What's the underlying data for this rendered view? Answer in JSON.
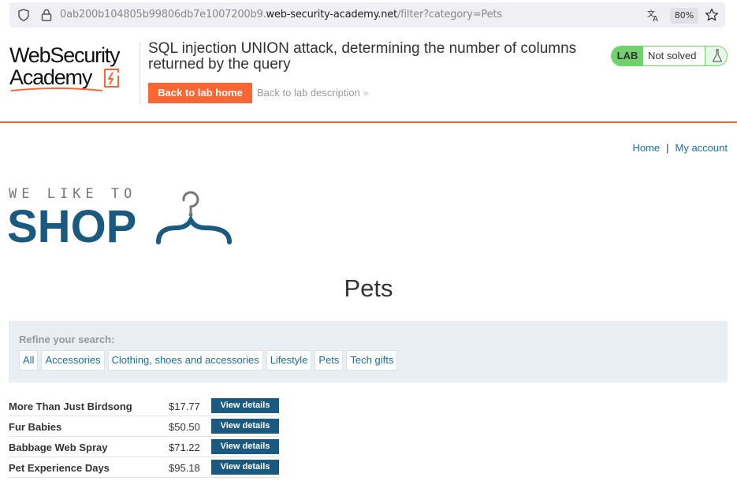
{
  "browser": {
    "url_prefix": "0ab200b104805b99806db7e1007200b9.",
    "url_domain": "web-security-academy.net",
    "url_path": "/filter?category=Pets",
    "zoom": "80%",
    "icons": [
      "shield-icon",
      "lock-icon",
      "translate-icon",
      "star-icon"
    ]
  },
  "academy": {
    "logo_line1": "WebSecurity",
    "logo_line2": "Academy",
    "lab_title": "SQL injection UNION attack, determining the number of columns returned by the query",
    "back_home": "Back to lab home",
    "back_description": "Back to lab description",
    "lab_badge": "LAB",
    "lab_status": "Not solved",
    "accent_color": "#ff6633",
    "status_color": "#70d16d"
  },
  "shop": {
    "nav": {
      "home": "Home",
      "separator": "|",
      "account": "My account"
    },
    "logo_tagline": "WE LIKE TO",
    "logo_word": "SHOP",
    "page_title": "Pets",
    "refine_label": "Refine your search:",
    "categories": [
      "All",
      "Accessories",
      "Clothing, shoes and accessories",
      "Lifestyle",
      "Pets",
      "Tech gifts"
    ],
    "products": [
      {
        "name": "More Than Just Birdsong",
        "price": "$17.77",
        "button": "View details"
      },
      {
        "name": "Fur Babies",
        "price": "$50.50",
        "button": "View details"
      },
      {
        "name": "Babbage Web Spray",
        "price": "$71.22",
        "button": "View details"
      },
      {
        "name": "Pet Experience Days",
        "price": "$95.18",
        "button": "View details"
      }
    ],
    "brand_color": "#1a5a80",
    "link_color": "#1a6ea0"
  }
}
